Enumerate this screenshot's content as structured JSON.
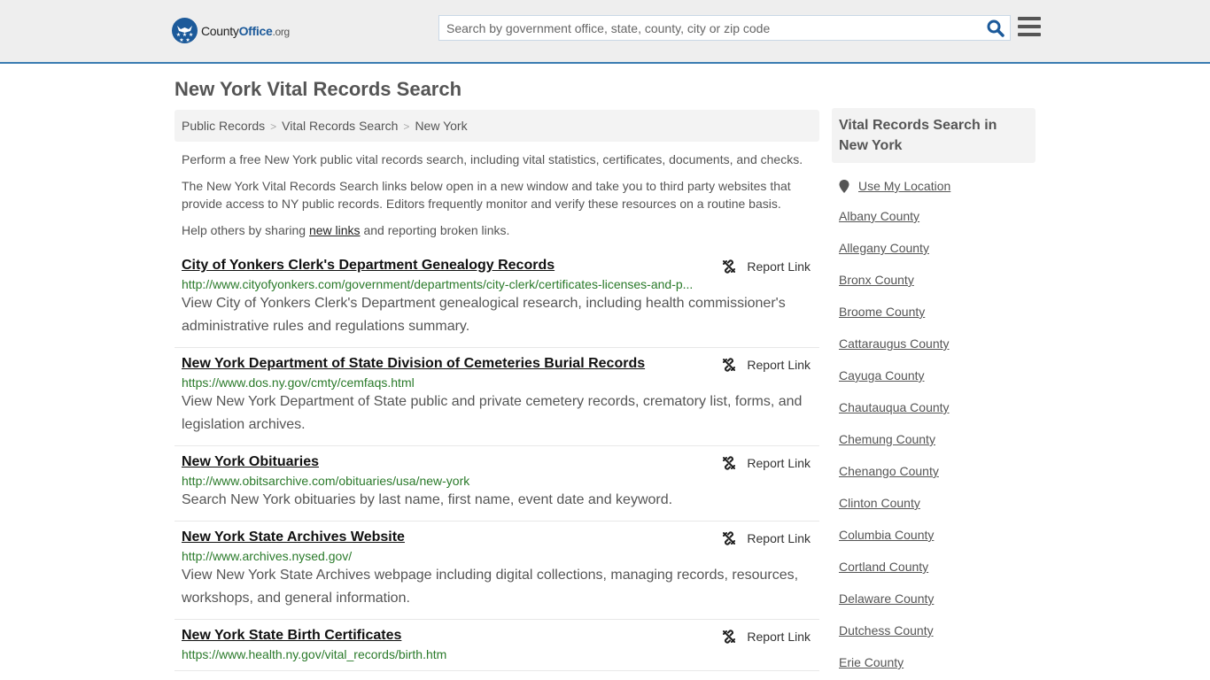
{
  "header": {
    "logo": {
      "part1": "County",
      "part2": "Office",
      "part3": ".org"
    },
    "search": {
      "placeholder": "Search by government office, state, county, city or zip code",
      "value": ""
    },
    "colors": {
      "brand": "#1c5a9a",
      "header_border": "#3a7cb1",
      "url_green": "#2a7a2a"
    }
  },
  "page": {
    "title": "New York Vital Records Search",
    "breadcrumb": [
      {
        "label": "Public Records"
      },
      {
        "label": "Vital Records Search"
      },
      {
        "label": "New York"
      }
    ],
    "intro1": "Perform a free New York public vital records search, including vital statistics, certificates, documents, and checks.",
    "intro2": "The New York Vital Records Search links below open in a new window and take you to third party websites that provide access to NY public records. Editors frequently monitor and verify these resources on a routine basis.",
    "intro3_pre": "Help others by sharing ",
    "intro3_link": "new links",
    "intro3_post": " and reporting broken links."
  },
  "results": [
    {
      "title": "City of Yonkers Clerk's Department Genealogy Records",
      "url": "http://www.cityofyonkers.com/government/departments/city-clerk/certificates-licenses-and-p...",
      "desc": "View City of Yonkers Clerk's Department genealogical research, including health commissioner's administrative rules and regulations summary.",
      "report": "Report Link"
    },
    {
      "title": "New York Department of State Division of Cemeteries Burial Records",
      "url": "https://www.dos.ny.gov/cmty/cemfaqs.html",
      "desc": "View New York Department of State public and private cemetery records, crematory list, forms, and legislation archives.",
      "report": "Report Link"
    },
    {
      "title": "New York Obituaries",
      "url": "http://www.obitsarchive.com/obituaries/usa/new-york",
      "desc": "Search New York obituaries by last name, first name, event date and keyword.",
      "report": "Report Link"
    },
    {
      "title": "New York State Archives Website",
      "url": "http://www.archives.nysed.gov/",
      "desc": "View New York State Archives webpage including digital collections, managing records, resources, workshops, and general information.",
      "report": "Report Link"
    },
    {
      "title": "New York State Birth Certificates",
      "url": "https://www.health.ny.gov/vital_records/birth.htm",
      "desc": "",
      "report": "Report Link"
    }
  ],
  "sidebar": {
    "heading": "Vital Records Search in New York",
    "use_location": "Use My Location",
    "counties": [
      "Albany County",
      "Allegany County",
      "Bronx County",
      "Broome County",
      "Cattaraugus County",
      "Cayuga County",
      "Chautauqua County",
      "Chemung County",
      "Chenango County",
      "Clinton County",
      "Columbia County",
      "Cortland County",
      "Delaware County",
      "Dutchess County",
      "Erie County"
    ]
  }
}
